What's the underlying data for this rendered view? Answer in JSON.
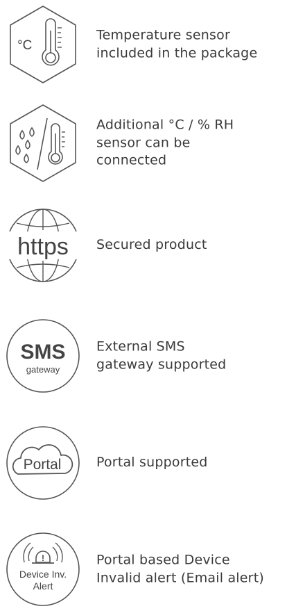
{
  "colors": {
    "icon_stroke": "#555555",
    "text": "#3a3a3a",
    "background": "#ffffff"
  },
  "features": [
    {
      "icon": "temperature-sensor-icon",
      "lines": [
        "Temperature sensor",
        "included in the package"
      ],
      "icon_text": [
        "°C"
      ]
    },
    {
      "icon": "humidity-temperature-sensor-icon",
      "lines": [
        "Additional °C / % RH",
        "sensor can be",
        "connected"
      ],
      "icon_text": []
    },
    {
      "icon": "https-globe-icon",
      "lines": [
        "Secured product"
      ],
      "icon_text": [
        "https"
      ]
    },
    {
      "icon": "sms-gateway-icon",
      "lines": [
        "External SMS",
        "gateway supported"
      ],
      "icon_text": [
        "SMS",
        "gateway"
      ]
    },
    {
      "icon": "portal-cloud-icon",
      "lines": [
        "Portal supported"
      ],
      "icon_text": [
        "Portal"
      ]
    },
    {
      "icon": "device-alert-icon",
      "lines": [
        "Portal based Device",
        "Invalid alert (Email alert)"
      ],
      "icon_text": [
        "Device Inv.",
        "Alert"
      ]
    }
  ]
}
